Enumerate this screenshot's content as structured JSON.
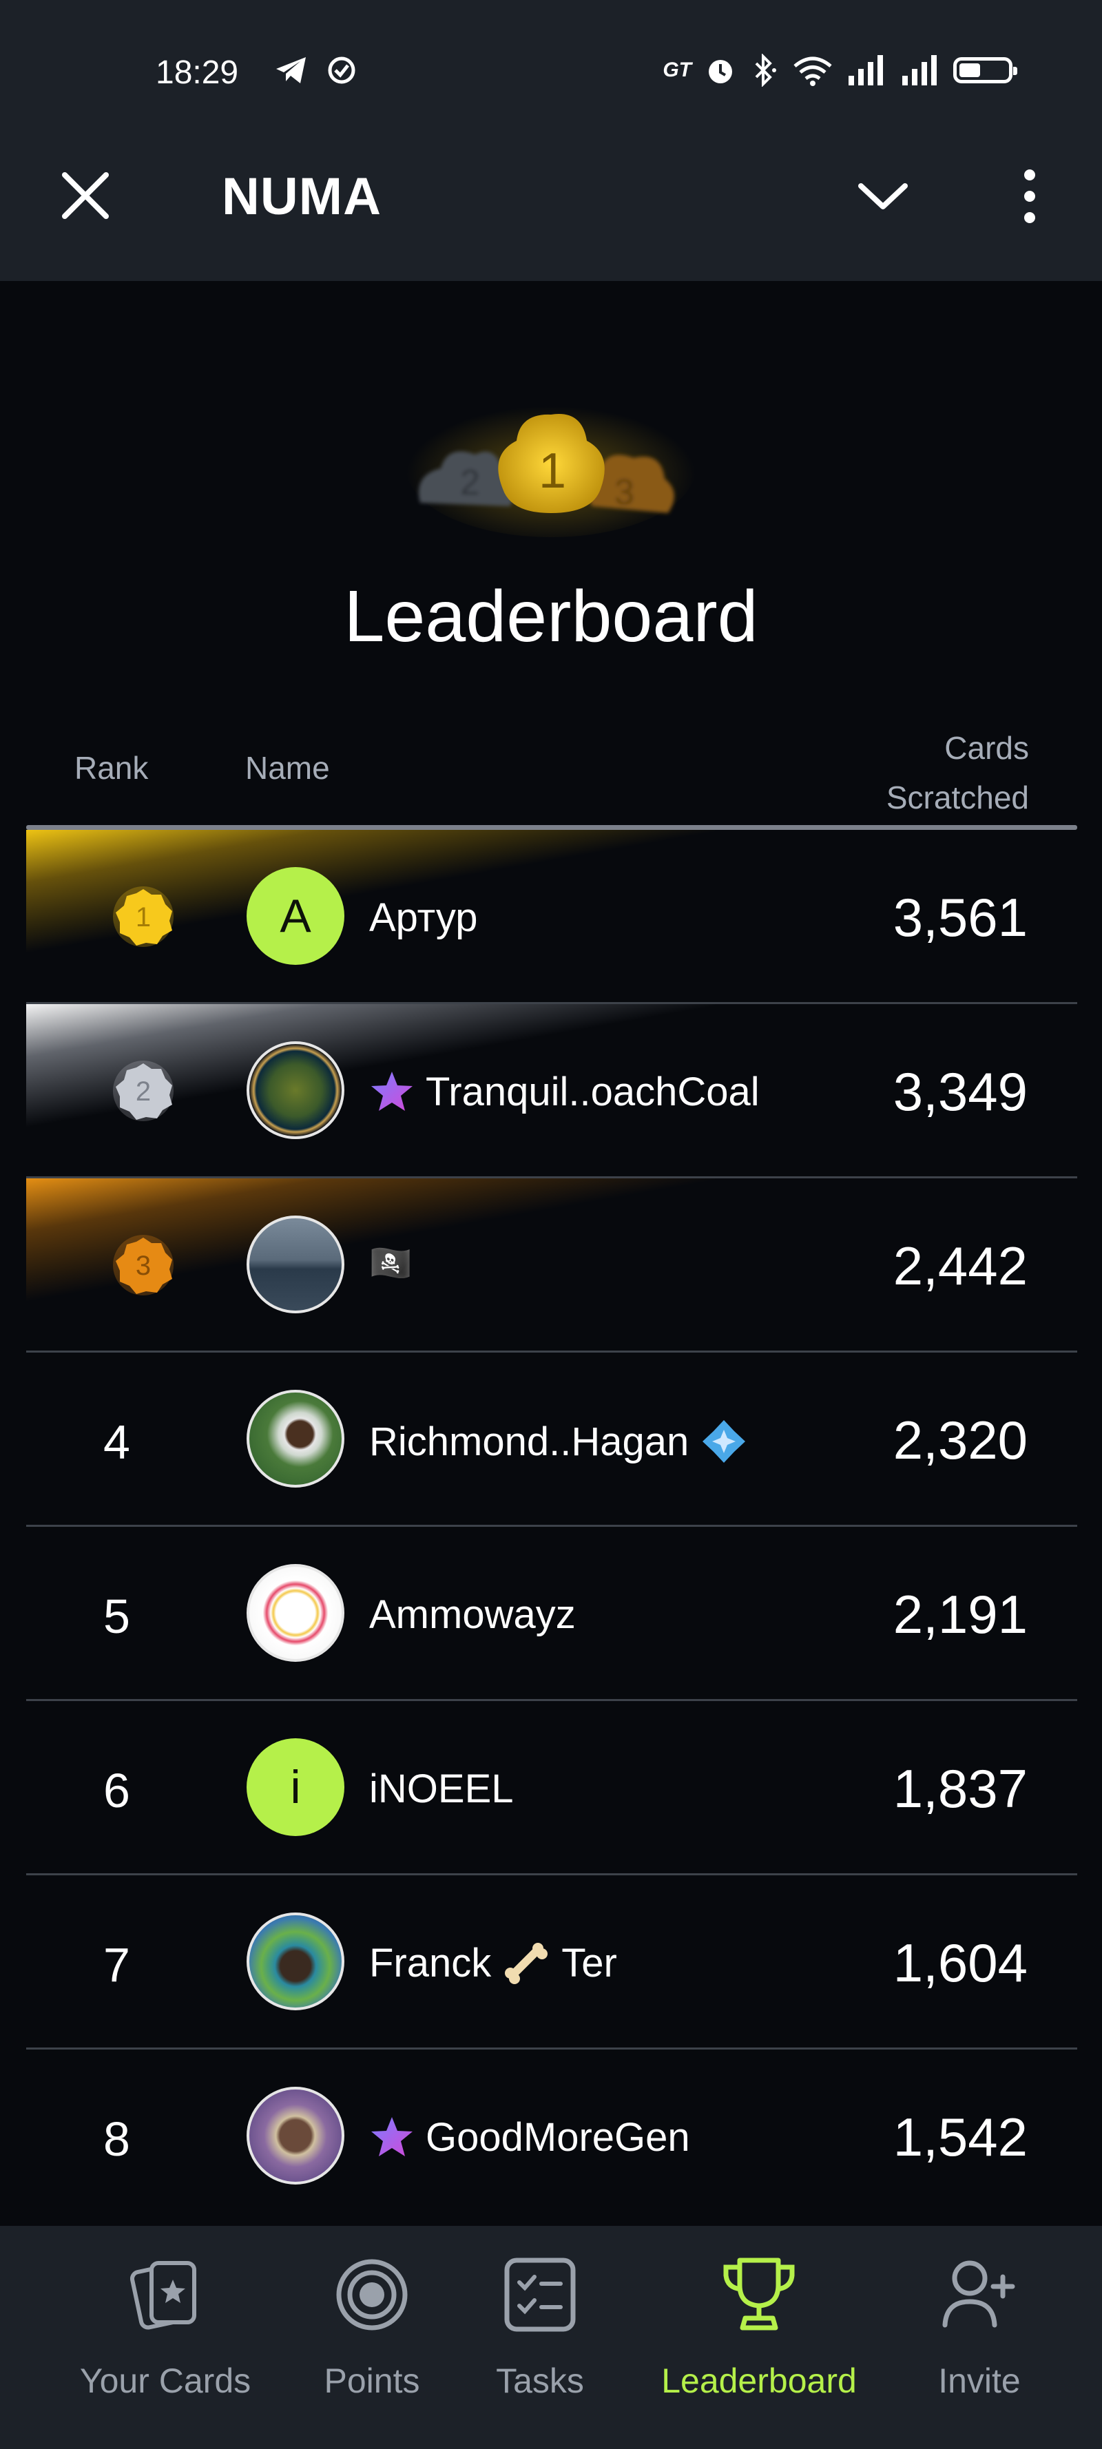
{
  "status_bar": {
    "time": "18:29",
    "network_label": "GT"
  },
  "header": {
    "title": "NUMA"
  },
  "page": {
    "title": "Leaderboard"
  },
  "podium_icon": {
    "places": [
      "2",
      "1",
      "3"
    ]
  },
  "table": {
    "columns": {
      "rank": "Rank",
      "name": "Name",
      "cards_line1": "Cards",
      "cards_line2": "Scratched"
    },
    "rows": [
      {
        "rank": "1",
        "name": "Артур",
        "avatar_letter": "A",
        "badge": "",
        "score": "3,561",
        "tier": "gold"
      },
      {
        "rank": "2",
        "name": "Tranquil..oachCoal",
        "avatar_letter": "",
        "badge": "star-icon",
        "score": "3,349",
        "tier": "silver"
      },
      {
        "rank": "3",
        "name": "🏴‍☠️",
        "avatar_letter": "",
        "badge": "",
        "score": "2,442",
        "tier": "bronze"
      },
      {
        "rank": "4",
        "name": "Richmond..Hagan",
        "avatar_letter": "",
        "badge": "diamond-icon",
        "score": "2,320",
        "tier": ""
      },
      {
        "rank": "5",
        "name": "Ammowayz",
        "avatar_letter": "",
        "badge": "",
        "score": "2,191",
        "tier": ""
      },
      {
        "rank": "6",
        "name": "iNOEEL",
        "avatar_letter": "i",
        "badge": "",
        "score": "1,837",
        "tier": ""
      },
      {
        "rank": "7",
        "name_part1": "Franck",
        "name_part2": "Ter",
        "avatar_letter": "",
        "badge": "bone-icon",
        "score": "1,604",
        "tier": ""
      },
      {
        "rank": "8",
        "name": "GoodMoreGen",
        "avatar_letter": "",
        "badge": "star-icon",
        "score": "1,542",
        "tier": ""
      }
    ]
  },
  "bottom_nav": {
    "items": [
      {
        "label": "Your Cards",
        "icon": "cards-icon"
      },
      {
        "label": "Points",
        "icon": "target-icon"
      },
      {
        "label": "Tasks",
        "icon": "checklist-icon"
      },
      {
        "label": "Leaderboard",
        "icon": "trophy-icon",
        "active": true
      },
      {
        "label": "Invite",
        "icon": "add-user-icon"
      }
    ]
  },
  "colors": {
    "accent": "#b5f04a",
    "gold": "#f7c91c",
    "silver": "#c7cbd3",
    "bronze": "#e68a14",
    "background": "#07090d",
    "bar": "#1c2128"
  }
}
